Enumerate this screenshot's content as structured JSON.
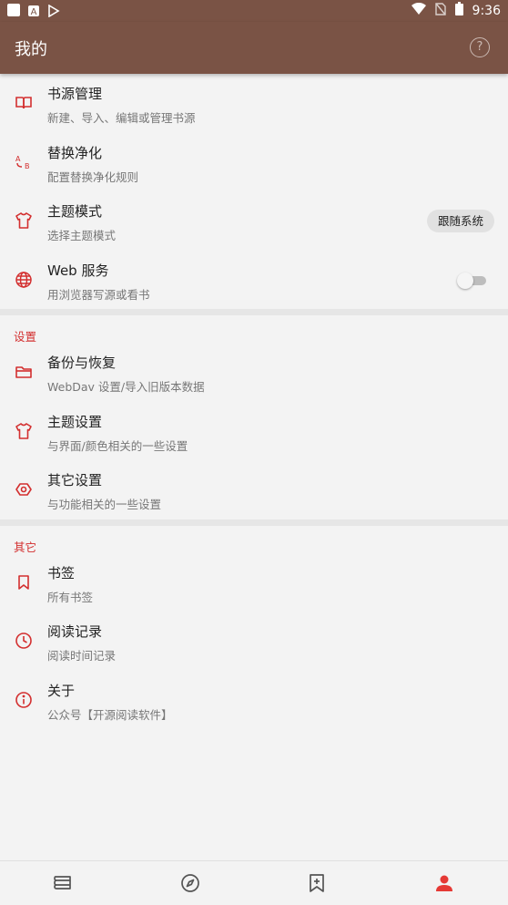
{
  "statusbar": {
    "time": "9:36"
  },
  "appbar": {
    "title": "我的",
    "help_icon": "help-circle-icon"
  },
  "main_items": [
    {
      "name": "book-source-manage",
      "title": "书源管理",
      "subtitle": "新建、导入、编辑或管理书源",
      "icon": "book-open-icon"
    },
    {
      "name": "replace-purify",
      "title": "替换净化",
      "subtitle": "配置替换净化规则",
      "icon": "a-to-b-replace-icon"
    },
    {
      "name": "theme-mode",
      "title": "主题模式",
      "subtitle": "选择主题模式",
      "icon": "tshirt-icon",
      "value": "跟随系统"
    },
    {
      "name": "web-service",
      "title": "Web 服务",
      "subtitle": "用浏览器写源或看书",
      "icon": "globe-icon",
      "enabled": false
    }
  ],
  "sections": [
    {
      "header": "设置",
      "items": [
        {
          "name": "backup-restore",
          "title": "备份与恢复",
          "subtitle": "WebDav 设置/导入旧版本数据",
          "icon": "folder-icon"
        },
        {
          "name": "theme-settings",
          "title": "主题设置",
          "subtitle": "与界面/颜色相关的一些设置",
          "icon": "tshirt-icon"
        },
        {
          "name": "other-settings",
          "title": "其它设置",
          "subtitle": "与功能相关的一些设置",
          "icon": "hexagon-settings-icon"
        }
      ]
    },
    {
      "header": "其它",
      "items": [
        {
          "name": "bookmarks",
          "title": "书签",
          "subtitle": "所有书签",
          "icon": "bookmark-icon"
        },
        {
          "name": "read-record",
          "title": "阅读记录",
          "subtitle": "阅读时间记录",
          "icon": "clock-icon"
        },
        {
          "name": "about",
          "title": "关于",
          "subtitle": "公众号【开源阅读软件】",
          "icon": "info-icon"
        }
      ]
    }
  ],
  "bottom_nav": [
    {
      "name": "bookshelf",
      "icon": "bookshelf-icon",
      "active": false
    },
    {
      "name": "discover",
      "icon": "compass-icon",
      "active": false
    },
    {
      "name": "rss",
      "icon": "bookmark-add-icon",
      "active": false
    },
    {
      "name": "my",
      "icon": "person-icon",
      "active": true
    }
  ],
  "colors": {
    "primary": "#7a5345",
    "accent": "#d32f2f",
    "background": "#f3f3f3"
  }
}
